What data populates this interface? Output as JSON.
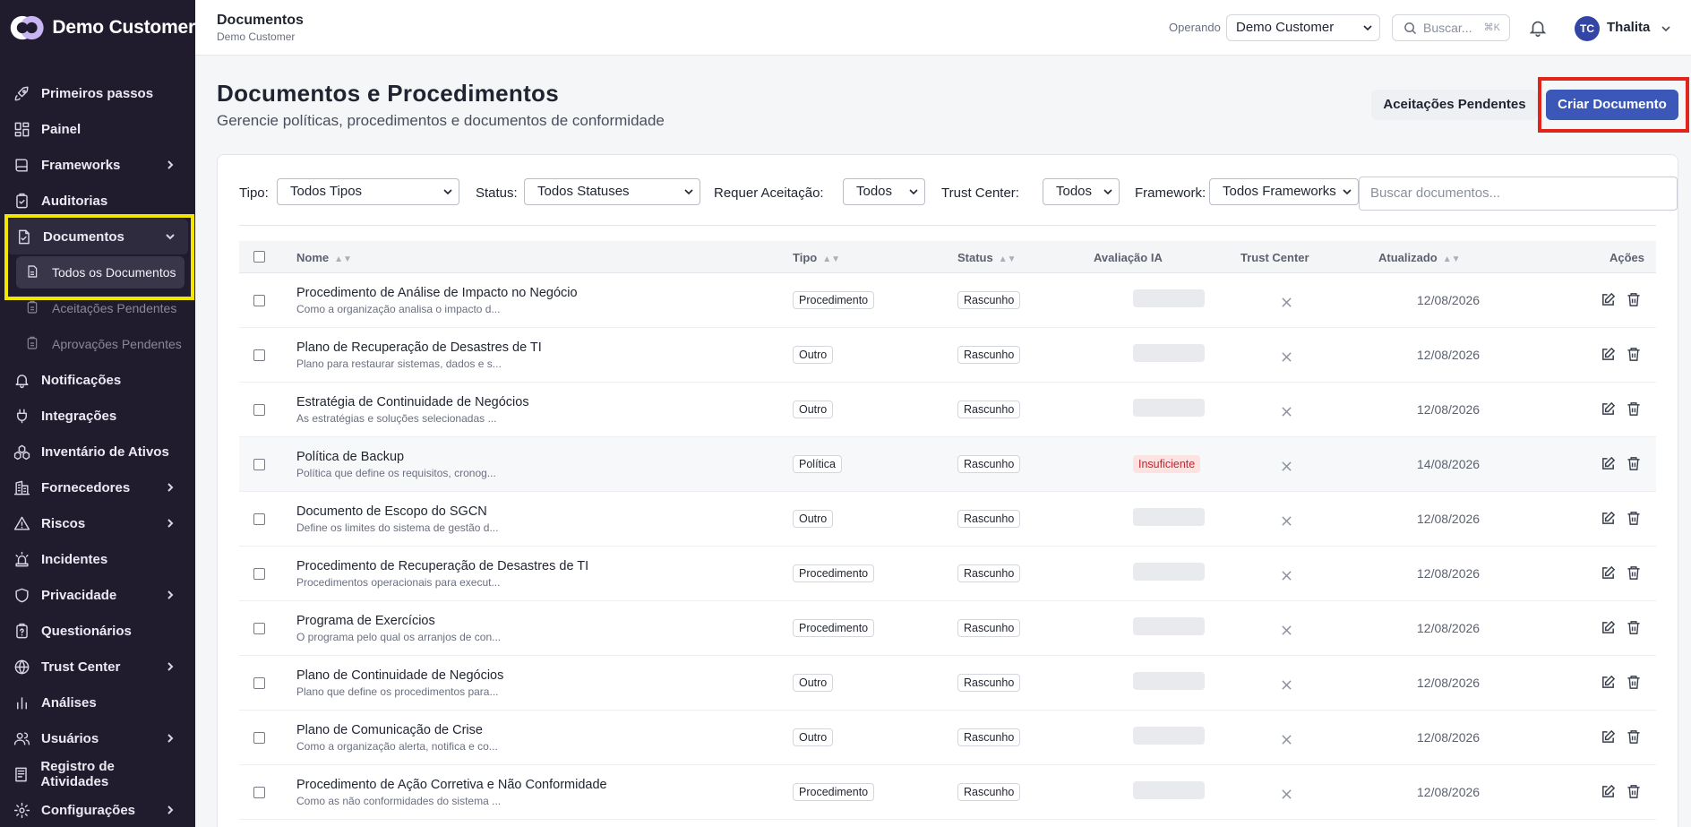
{
  "brand": {
    "name": "Demo Customer"
  },
  "sidebar": {
    "items": [
      {
        "label": "Primeiros passos",
        "icon": "rocket-icon"
      },
      {
        "label": "Painel",
        "icon": "dashboard-icon"
      },
      {
        "label": "Frameworks",
        "icon": "book-icon",
        "chevron": true
      },
      {
        "label": "Auditorias",
        "icon": "clipboard-check-icon"
      },
      {
        "label": "Documentos",
        "icon": "document-icon",
        "expanded": true
      },
      {
        "label": "Notificações",
        "icon": "bell-icon"
      },
      {
        "label": "Integrações",
        "icon": "plug-icon"
      },
      {
        "label": "Inventário de Ativos",
        "icon": "assets-icon"
      },
      {
        "label": "Fornecedores",
        "icon": "building-icon",
        "chevron": true
      },
      {
        "label": "Riscos",
        "icon": "warning-icon",
        "chevron": true
      },
      {
        "label": "Incidentes",
        "icon": "siren-icon"
      },
      {
        "label": "Privacidade",
        "icon": "shield-icon",
        "chevron": true
      },
      {
        "label": "Questionários",
        "icon": "questionnaire-icon"
      },
      {
        "label": "Trust Center",
        "icon": "globe-icon",
        "chevron": true
      },
      {
        "label": "Análises",
        "icon": "bar-chart-icon"
      },
      {
        "label": "Usuários",
        "icon": "users-icon",
        "chevron": true
      },
      {
        "label": "Registro de Atividades",
        "icon": "activity-log-icon"
      },
      {
        "label": "Configurações",
        "icon": "gear-icon",
        "chevron": true
      }
    ],
    "documentos_sub": [
      {
        "label": "Todos os Documentos",
        "active": true
      },
      {
        "label": "Aceitações Pendentes"
      },
      {
        "label": "Aprovações Pendentes"
      }
    ]
  },
  "topbar": {
    "title": "Documentos",
    "subtitle": "Demo Customer",
    "operando_label": "Operando",
    "operando_value": "Demo Customer",
    "search_placeholder": "Buscar...",
    "search_shortcut": "⌘K",
    "avatar_initials": "TC",
    "user_name": "Thalita"
  },
  "header": {
    "title": "Documentos e Procedimentos",
    "subtitle": "Gerencie políticas, procedimentos e documentos de conformidade",
    "pending_button": "Aceitações Pendentes",
    "create_button": "Criar Documento"
  },
  "filters": {
    "tipo_label": "Tipo:",
    "tipo_value": "Todos Tipos",
    "status_label": "Status:",
    "status_value": "Todos Statuses",
    "aceite_label": "Requer Aceitação:",
    "aceite_value": "Todos",
    "trust_label": "Trust Center:",
    "trust_value": "Todos",
    "framework_label": "Framework:",
    "framework_value": "Todos Frameworks",
    "search_placeholder": "Buscar documentos..."
  },
  "table": {
    "columns": {
      "nome": "Nome",
      "tipo": "Tipo",
      "status": "Status",
      "ia": "Avaliação IA",
      "trust": "Trust Center",
      "atualizado": "Atualizado",
      "acoes": "Ações"
    },
    "rows": [
      {
        "name": "Procedimento de Análise de Impacto no Negócio",
        "desc": "Como a organização analisa o impacto d...",
        "type": "Procedimento",
        "status": "Rascunho",
        "ia": "",
        "date": "12/08/2026"
      },
      {
        "name": "Plano de Recuperação de Desastres de TI",
        "desc": "Plano para restaurar sistemas, dados e s...",
        "type": "Outro",
        "status": "Rascunho",
        "ia": "",
        "date": "12/08/2026"
      },
      {
        "name": "Estratégia de Continuidade de Negócios",
        "desc": "As estratégias e soluções selecionadas ...",
        "type": "Outro",
        "status": "Rascunho",
        "ia": "",
        "date": "12/08/2026"
      },
      {
        "name": "Política de Backup",
        "desc": "Política que define os requisitos, cronog...",
        "type": "Política",
        "status": "Rascunho",
        "ia": "Insuficiente",
        "date": "14/08/2026"
      },
      {
        "name": "Documento de Escopo do SGCN",
        "desc": "Define os limites do sistema de gestão d...",
        "type": "Outro",
        "status": "Rascunho",
        "ia": "",
        "date": "12/08/2026"
      },
      {
        "name": "Procedimento de Recuperação de Desastres de TI",
        "desc": "Procedimentos operacionais para execut...",
        "type": "Procedimento",
        "status": "Rascunho",
        "ia": "",
        "date": "12/08/2026"
      },
      {
        "name": "Programa de Exercícios",
        "desc": "O programa pelo qual os arranjos de con...",
        "type": "Procedimento",
        "status": "Rascunho",
        "ia": "",
        "date": "12/08/2026"
      },
      {
        "name": "Plano de Continuidade de Negócios",
        "desc": "Plano que define os procedimentos para...",
        "type": "Outro",
        "status": "Rascunho",
        "ia": "",
        "date": "12/08/2026"
      },
      {
        "name": "Plano de Comunicação de Crise",
        "desc": "Como a organização alerta, notifica e co...",
        "type": "Outro",
        "status": "Rascunho",
        "ia": "",
        "date": "12/08/2026"
      },
      {
        "name": "Procedimento de Ação Corretiva e Não Conformidade",
        "desc": "Como as não conformidades do sistema ...",
        "type": "Procedimento",
        "status": "Rascunho",
        "ia": "",
        "date": "12/08/2026"
      }
    ]
  },
  "colors": {
    "sidebar_bg": "#201c2e",
    "primary": "#3b57b8",
    "highlight_yellow": "#f2e600",
    "highlight_red": "#e1251b"
  }
}
